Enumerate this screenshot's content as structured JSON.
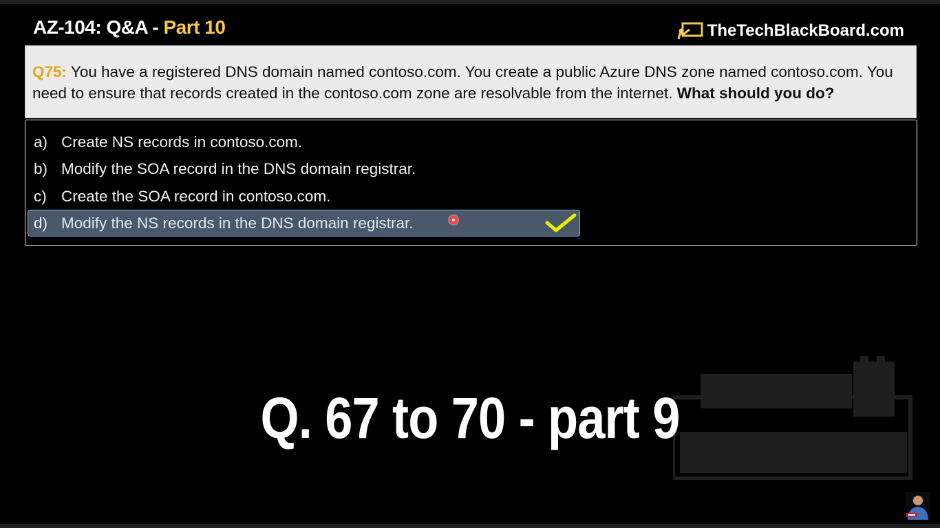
{
  "header": {
    "title": "AZ-104: Q&A",
    "separator": " - ",
    "part": "Part 10",
    "brand": "TheTechBlackBoard.com"
  },
  "question": {
    "number": "Q75:",
    "text": " You have a registered DNS domain named contoso.com. You create a public Azure DNS zone named contoso.com. You need to ensure that records created in the contoso.com zone are resolvable from the internet. ",
    "ask": "What should you do?"
  },
  "options": [
    {
      "letter": "a)",
      "text": "Create NS records in contoso.com."
    },
    {
      "letter": "b)",
      "text": "Modify the SOA record in the DNS domain registrar."
    },
    {
      "letter": "c)",
      "text": "Create the SOA record in contoso.com."
    },
    {
      "letter": "d)",
      "text": "Modify the NS records in the DNS domain registrar.",
      "correct": true
    }
  ],
  "overlay": {
    "next_part": "Q. 67 to 70 - part 9"
  },
  "colors": {
    "accent": "#f5c84c",
    "question_number": "#e8a61a",
    "correct_highlight": "#4a586c",
    "check": "#e6f000"
  },
  "icons": [
    "brand-logo-icon",
    "checkmark-icon",
    "cursor-dot-icon",
    "watermark-logo",
    "presenter-avatar"
  ]
}
